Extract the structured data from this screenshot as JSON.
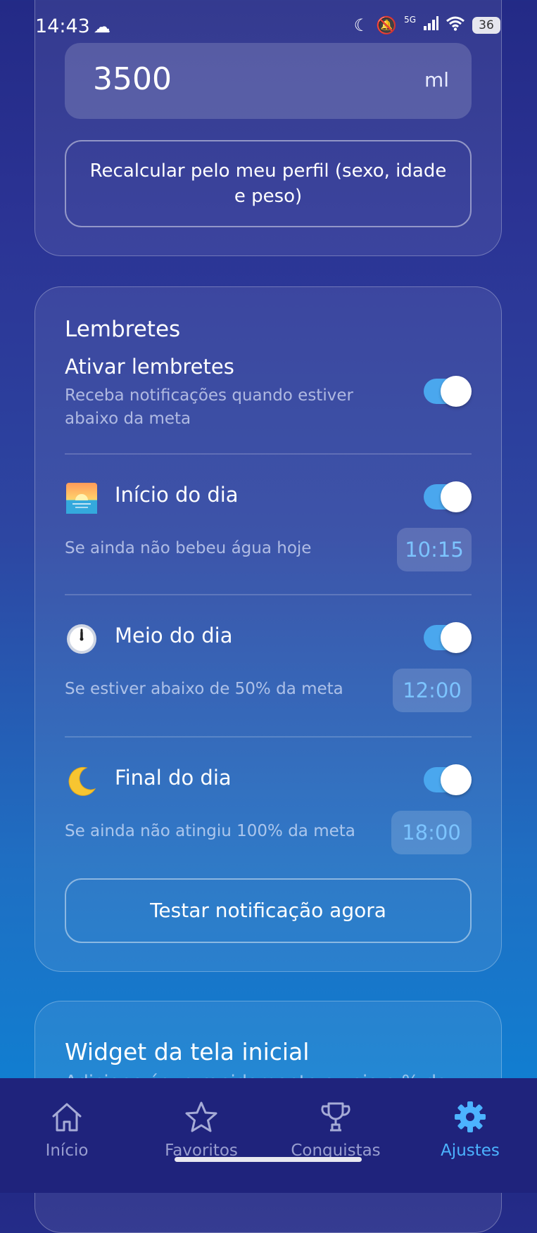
{
  "status_bar": {
    "time": "14:43",
    "battery": "36",
    "network": "5G"
  },
  "goal": {
    "value": "3500",
    "unit": "ml",
    "recalc_label": "Recalcular pelo meu perfil (sexo, idade e peso)"
  },
  "reminders": {
    "section_title": "Lembretes",
    "enable_title": "Ativar lembretes",
    "enable_desc": "Receba notificações quando estiver abaixo da meta",
    "enable_on": true,
    "items": [
      {
        "icon": "sunrise-icon",
        "title": "Início do dia",
        "desc": "Se ainda não bebeu água hoje",
        "time": "10:15",
        "on": true
      },
      {
        "icon": "clock-icon",
        "title": "Meio do dia",
        "desc": "Se estiver abaixo de 50% da meta",
        "time": "12:00",
        "on": true
      },
      {
        "icon": "crescent-moon-icon",
        "title": "Final do dia",
        "desc": "Se ainda não atingiu 100% da meta",
        "time": "18:00",
        "on": true
      }
    ],
    "test_label": "Testar notificação agora"
  },
  "widget": {
    "title": "Widget da tela inicial",
    "subtitle": "Adicione água rapidamente e veja o % da"
  },
  "nav": {
    "items": [
      {
        "label": "Início",
        "icon": "home-icon",
        "active": false
      },
      {
        "label": "Favoritos",
        "icon": "star-icon",
        "active": false
      },
      {
        "label": "Conquistas",
        "icon": "trophy-icon",
        "active": false
      },
      {
        "label": "Ajustes",
        "icon": "gear-icon",
        "active": true
      }
    ]
  },
  "colors": {
    "accent": "#4cb3ff",
    "toggle_on": "#4aa7ee",
    "time_text": "#7cc4ff",
    "nav_bg": "#1f237c"
  }
}
